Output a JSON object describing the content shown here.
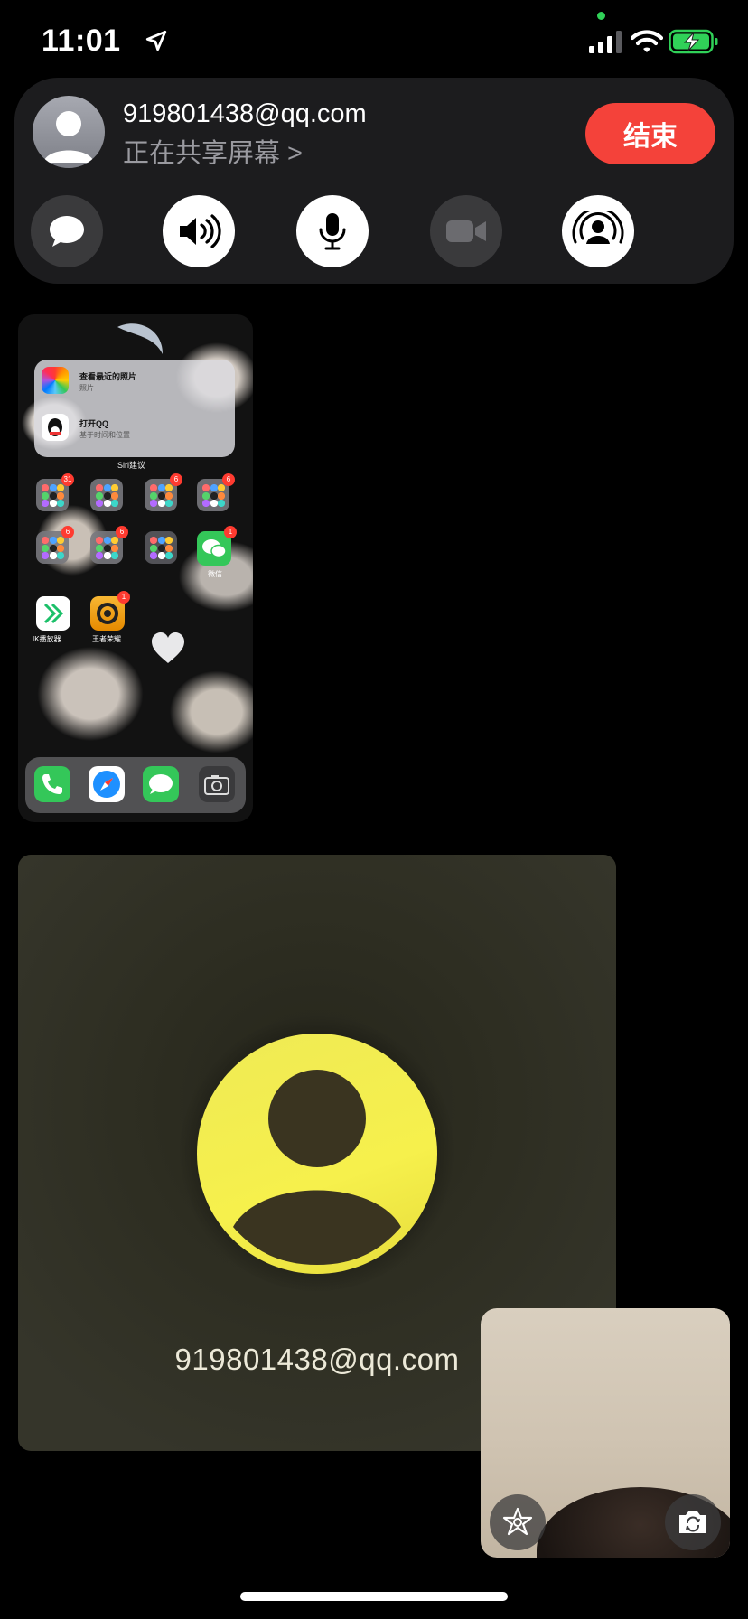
{
  "status_bar": {
    "time": "11:01",
    "icons": [
      "location-arrow-icon",
      "signal-icon",
      "wifi-icon",
      "battery-charging-icon"
    ],
    "privacy_indicator_color": "#30d158",
    "battery_color": "#30d158"
  },
  "call_banner": {
    "caller": "919801438@qq.com",
    "status": "正在共享屏幕 >",
    "end_label": "结束",
    "end_color": "#f4423a",
    "controls": [
      {
        "name": "message",
        "icon": "message-bubble-icon",
        "state": "inactive"
      },
      {
        "name": "speaker",
        "icon": "speaker-icon",
        "state": "active"
      },
      {
        "name": "microphone",
        "icon": "microphone-icon",
        "state": "active"
      },
      {
        "name": "camera",
        "icon": "video-camera-icon",
        "state": "disabled"
      },
      {
        "name": "shareplay",
        "icon": "shareplay-icon",
        "state": "active"
      }
    ]
  },
  "shared_screen": {
    "siri_suggestions": [
      {
        "title": "查看最近的照片",
        "subtitle": "照片"
      },
      {
        "title": "打开QQ",
        "subtitle": "基于时间和位置"
      }
    ],
    "siri_label": "Siri建议",
    "badges": [
      "31",
      "6",
      "6",
      "6",
      "6",
      "1",
      "1"
    ],
    "apps": [
      {
        "label": "微信"
      },
      {
        "label": "IK播放器"
      },
      {
        "label": "王者荣耀"
      }
    ],
    "dock": [
      "phone-icon",
      "safari-icon",
      "messages-icon",
      "camera-icon"
    ]
  },
  "participant": {
    "name": "919801438@qq.com",
    "avatar_color": "#f2ec4e"
  },
  "self_view": {
    "buttons": [
      "effects-star-icon",
      "flip-camera-icon"
    ]
  }
}
